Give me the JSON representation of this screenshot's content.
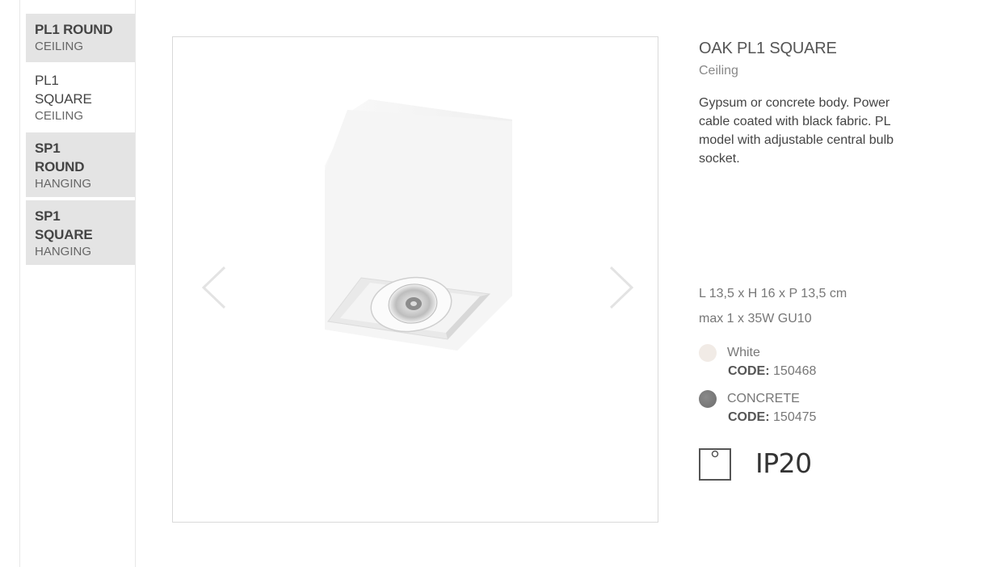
{
  "sidebar": {
    "items": [
      {
        "name": "PL1 ROUND",
        "category": "CEILING",
        "active": false
      },
      {
        "name": "PL1 SQUARE",
        "category": "CEILING",
        "active": true
      },
      {
        "name": "SP1 ROUND",
        "category": "HANGING",
        "active": false
      },
      {
        "name": "SP1 SQUARE",
        "category": "HANGING",
        "active": false
      }
    ]
  },
  "gallery": {
    "prev_icon": "chevron-left-icon",
    "next_icon": "chevron-right-icon"
  },
  "product": {
    "title": "OAK PL1 SQUARE",
    "subtitle": "Ceiling",
    "description": "Gypsum or concrete body. Power cable coated with black fabric. PL model with adjustable central bulb socket.",
    "dimensions": "L 13,5 x H 16 x P 13,5 cm",
    "lamp": "max 1 x 35W GU10",
    "variants": [
      {
        "name": "White",
        "code_label": "CODE:",
        "code": "150468",
        "color": "#f1ebe6"
      },
      {
        "name": "CONCRETE",
        "code_label": "CODE:",
        "code": "150475",
        "color": "#7b7b7b"
      }
    ],
    "ip_rating": "IP20"
  }
}
